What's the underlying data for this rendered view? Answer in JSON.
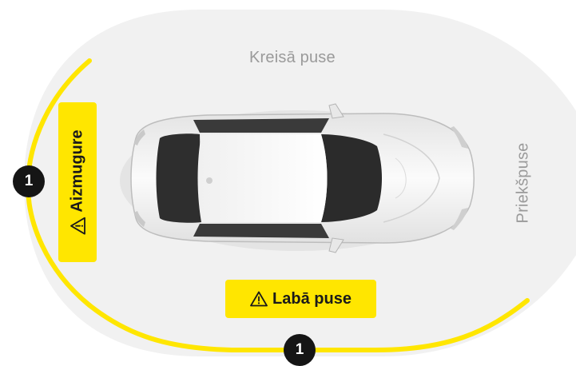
{
  "zones": {
    "left_side": "Kreisā puse",
    "front": "Priekšpuse",
    "right_side": "Labā puse",
    "rear": "Aizmugure"
  },
  "badges": {
    "rear_count": "1",
    "right_count": "1"
  },
  "icons": {
    "warning": "warning-triangle-icon",
    "car": "car-top-view-icon"
  },
  "colors": {
    "highlight": "#FFE600",
    "zone_background": "#F1F1F1",
    "badge": "#151515",
    "muted_label": "#9A9A9A"
  }
}
